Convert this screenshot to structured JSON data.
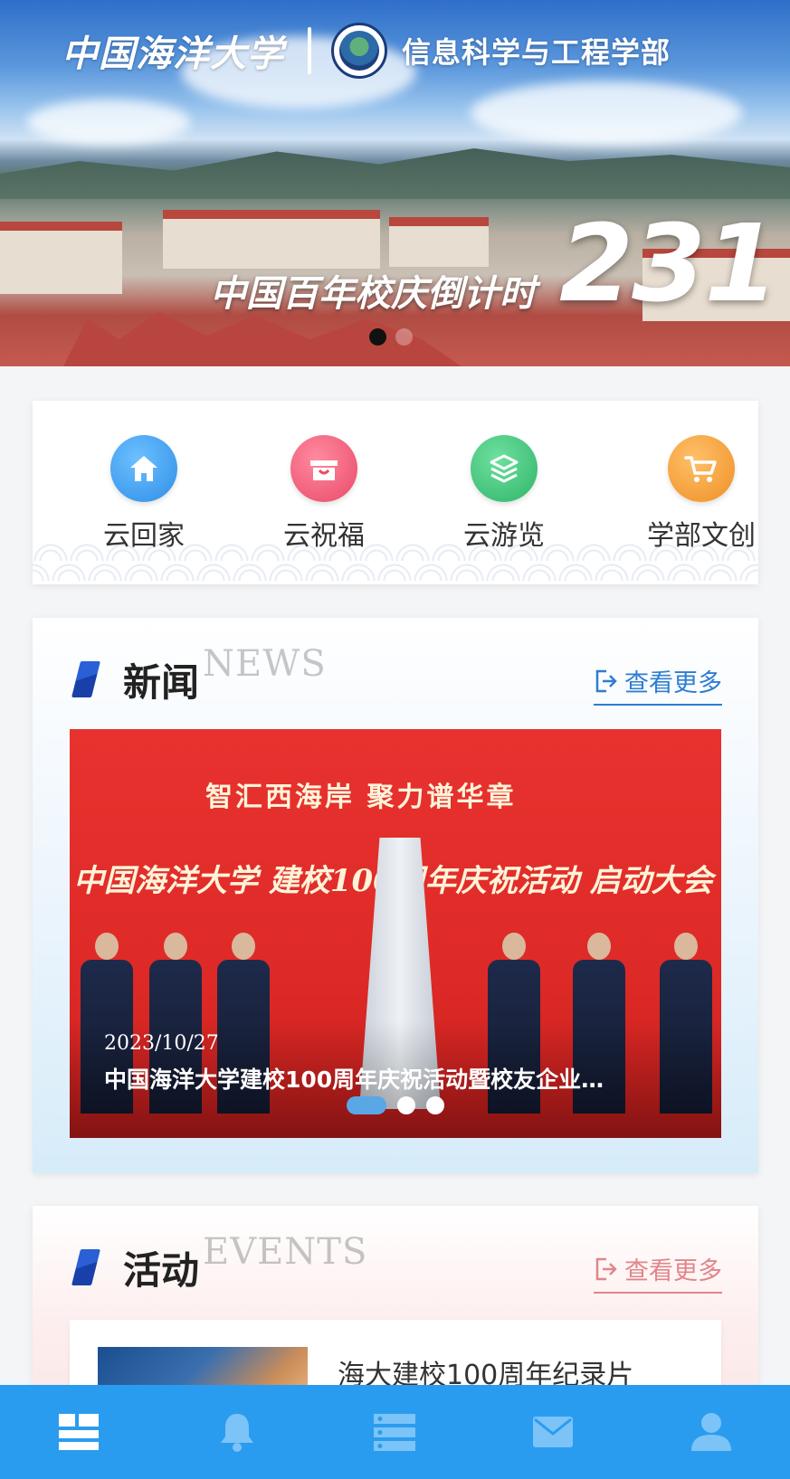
{
  "hero": {
    "school_name": "中国海洋大学",
    "department": "信息科学与工程学部",
    "countdown_label": "中国百年校庆倒计时",
    "countdown_value": "231",
    "slide_count": 2,
    "active_slide": 1
  },
  "quick_links": [
    {
      "label": "云回家",
      "icon": "home-icon",
      "color": "#3d9cf0"
    },
    {
      "label": "云祝福",
      "icon": "gift-icon",
      "color": "#f2607a"
    },
    {
      "label": "云游览",
      "icon": "layers-icon",
      "color": "#3ec27a"
    },
    {
      "label": "学部文创",
      "icon": "cart-icon",
      "color": "#f4a23e"
    }
  ],
  "news": {
    "title": "新闻",
    "ghost": "NEWS",
    "more_label": "查看更多",
    "banner": {
      "slogan": "智汇西海岸    聚力谱华章",
      "headline": "中国海洋大学  建校100周年庆祝活动  启动大会"
    },
    "date": "2023/10/27",
    "headline": "中国海洋大学建校100周年庆祝活动暨校友企业…",
    "slide_count": 3,
    "active_slide": 1
  },
  "events": {
    "title": "活动",
    "ghost": "EVENTS",
    "more_label": "查看更多",
    "item_title": "海大建校100周年纪录片"
  },
  "tabbar": {
    "tabs": [
      {
        "icon": "dashboard-icon",
        "active": true
      },
      {
        "icon": "bell-icon",
        "active": false
      },
      {
        "icon": "list-icon",
        "active": false
      },
      {
        "icon": "mail-icon",
        "active": false
      },
      {
        "icon": "user-icon",
        "active": false
      }
    ],
    "active_color": "#ffffff",
    "inactive_color": "#7cc3f7",
    "background": "#2a9cf0"
  }
}
